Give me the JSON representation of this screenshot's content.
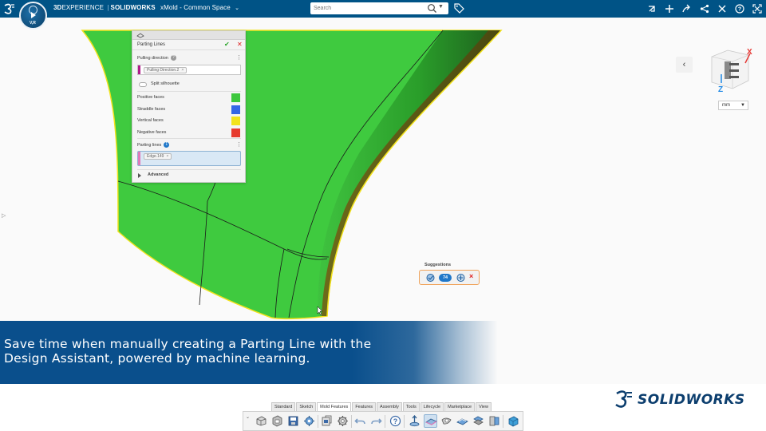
{
  "topbar": {
    "brand_3d": "3D",
    "brand_experience": "EXPERIENCE",
    "brand_sep": "|",
    "brand_solidworks": "SOLIDWORKS",
    "app_name": "xMold - Common Space",
    "search_placeholder": "Search",
    "compass_label": "3D",
    "compass_sub": "V,R",
    "right_icons": [
      "share-arrow-icon",
      "add-icon",
      "forward-icon",
      "network-icon",
      "tools-icon",
      "help-icon",
      "fullscreen-icon"
    ]
  },
  "panel": {
    "title": "Parting Lines",
    "pulling_direction_label": "Pulling direction",
    "pulling_direction_value": "Pulling Direction.2",
    "split_silhouette_label": "Split silhouette",
    "faces": [
      {
        "label": "Positive faces",
        "color": "#3cc73c"
      },
      {
        "label": "Straddle faces",
        "color": "#3366e6"
      },
      {
        "label": "Vertical faces",
        "color": "#f2e21c"
      },
      {
        "label": "Negative faces",
        "color": "#e63b2e"
      }
    ],
    "parting_lines_label": "Parting lines",
    "parting_lines_count": "1",
    "parting_line_value": "Edge.149",
    "advanced_label": "Advanced",
    "help_symbol": "?"
  },
  "view": {
    "units": "mm",
    "axis_x": "X",
    "axis_z": "Z"
  },
  "suggestions": {
    "label": "Suggestions",
    "count": "74"
  },
  "caption": "Save time when manually creating a Parting Line with the Design Assistant, powered by machine learning.",
  "logo_text": "SOLIDWORKS",
  "tabs": [
    "Standard",
    "Sketch",
    "Mold Features",
    "Features",
    "Assembly",
    "Tools",
    "Lifecycle",
    "Marketplace",
    "View"
  ],
  "active_tab": "Mold Features",
  "toolbar_icons": [
    "part-icon",
    "shell-icon",
    "save-icon",
    "settings-gear-icon",
    "export-icon",
    "gear-icon",
    "undo-icon",
    "redo-icon",
    "help-icon",
    "pulling-direction-icon",
    "parting-lines-icon",
    "shutoff-icon",
    "parting-surface-icon",
    "core-cavity-icon",
    "tooling-split-icon",
    "mold-base-icon"
  ],
  "colors": {
    "topbar": "#005386",
    "positive": "#3cc73c",
    "highlight": "#f2e21c",
    "banner": "#0a4f8c"
  }
}
